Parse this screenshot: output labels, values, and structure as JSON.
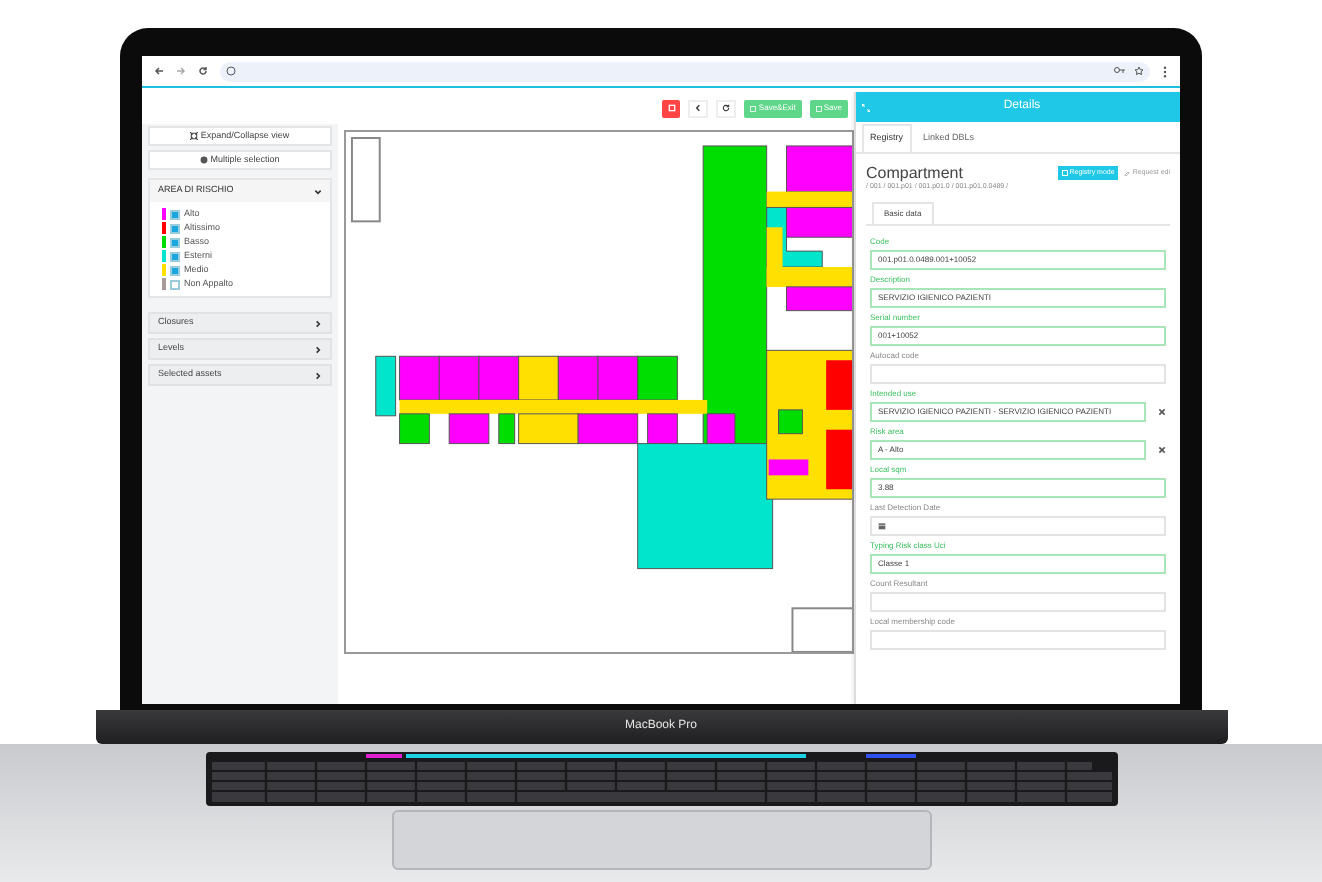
{
  "laptop": {
    "brand_label": "MacBook Pro"
  },
  "toolbar": {
    "buttons": [
      {
        "kind": "delete"
      },
      {
        "kind": "back"
      },
      {
        "kind": "refresh"
      },
      {
        "kind": "save",
        "label": "Save&Exit"
      },
      {
        "kind": "save",
        "label": "Save"
      }
    ]
  },
  "sidebar": {
    "actions": [
      {
        "kind": "expand",
        "label": "Expand/Collapse view"
      },
      {
        "kind": "multi",
        "label": "Multiple selection"
      }
    ],
    "risk_panel": {
      "title": "AREA DI RISCHIO",
      "expanded": true,
      "legend": [
        {
          "label": "Alto",
          "color": "#ff00ff",
          "checked": true
        },
        {
          "label": "Altissimo",
          "color": "#ff0000",
          "checked": true
        },
        {
          "label": "Basso",
          "color": "#00dd00",
          "checked": true
        },
        {
          "label": "Esterni",
          "color": "#00e5cc",
          "checked": true
        },
        {
          "label": "Medio",
          "color": "#ffe000",
          "checked": true
        },
        {
          "label": "Non Appalto",
          "color": "#a89a9a",
          "checked": false
        }
      ]
    },
    "sections": [
      {
        "title": "Closures",
        "expanded": false
      },
      {
        "title": "Levels",
        "expanded": false
      },
      {
        "title": "Selected assets",
        "expanded": false
      }
    ]
  },
  "details": {
    "title": "Details",
    "tabs": [
      {
        "label": "Registry",
        "selected": true
      },
      {
        "label": "Linked DBLs",
        "selected": false
      }
    ],
    "heading": "Compartment",
    "breadcrumb": "/ 001 / 001.p01 / 001.p01.0 / 001.p01.0.0489 /",
    "mode_button": "Registry mode",
    "edit_link": "Request edi",
    "subtabs": [
      {
        "label": "Basic data",
        "selected": true
      }
    ],
    "fields": [
      {
        "kind": "text",
        "label": "Code",
        "value": "001.p01.0.0489.001+10052",
        "valid": true
      },
      {
        "kind": "text",
        "label": "Description",
        "value": "SERVIZIO IGIENICO PAZIENTI",
        "valid": true
      },
      {
        "kind": "text",
        "label": "Serial number",
        "value": "001+10052",
        "valid": true
      },
      {
        "kind": "text",
        "label": "Autocad code",
        "valid": false
      },
      {
        "kind": "select",
        "label": "Intended use",
        "value": "SERVIZIO IGIENICO PAZIENTI - SERVIZIO IGIENICO PAZIENTI",
        "valid": true
      },
      {
        "kind": "select",
        "label": "Risk area",
        "value": "A - Alto",
        "valid": true
      },
      {
        "kind": "text",
        "label": "Local sqm",
        "value": "3.88",
        "valid": true
      },
      {
        "kind": "date",
        "label": "Last Detection Date",
        "valid": false
      },
      {
        "kind": "text",
        "label": "Typing Risk class Uci",
        "value": "Classe 1",
        "valid": true
      },
      {
        "kind": "text",
        "label": "Count Resultant",
        "valid": false
      },
      {
        "kind": "text",
        "label": "Local membership code",
        "valid": false
      }
    ]
  }
}
